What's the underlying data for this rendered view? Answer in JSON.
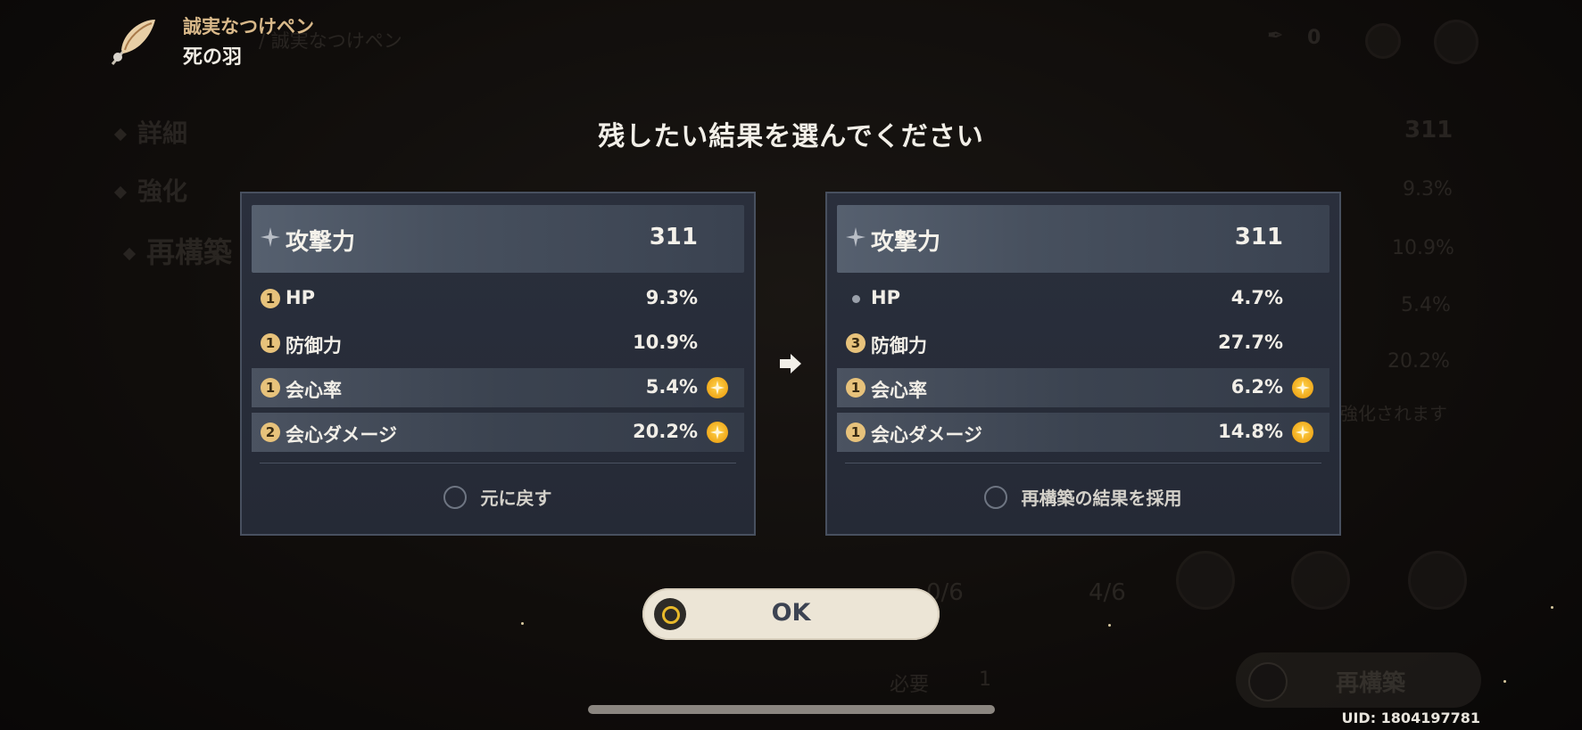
{
  "header": {
    "set_name": "誠実なつけペン",
    "piece_name": "死の羽",
    "icon": "feather-icon"
  },
  "background": {
    "breadcrumb": "/ 誠実なつけペン",
    "material_count": "0",
    "nav": [
      "詳細",
      "強化",
      "再構築"
    ],
    "stats": [
      "311",
      "9.3%",
      "10.9%",
      "5.4%",
      "20.2%"
    ],
    "note": "強化されます",
    "required_label": "必要",
    "required_count": "1",
    "progress_a": "0/6",
    "progress_b": "4/6",
    "reroll_label": "再構築"
  },
  "dialog": {
    "title": "残したい結果を選んでください",
    "left": {
      "main": {
        "name": "攻撃力",
        "value": "311"
      },
      "subs": [
        {
          "badge": "1",
          "name": "HP",
          "value": "9.3%",
          "upgraded": false,
          "highlight": false
        },
        {
          "badge": "1",
          "name": "防御力",
          "value": "10.9%",
          "upgraded": false,
          "highlight": false
        },
        {
          "badge": "1",
          "name": "会心率",
          "value": "5.4%",
          "upgraded": true,
          "highlight": true
        },
        {
          "badge": "2",
          "name": "会心ダメージ",
          "value": "20.2%",
          "upgraded": true,
          "highlight": true
        }
      ],
      "choice": "元に戻す"
    },
    "right": {
      "main": {
        "name": "攻撃力",
        "value": "311"
      },
      "subs": [
        {
          "badge": "",
          "name": "HP",
          "value": "4.7%",
          "upgraded": false,
          "highlight": false
        },
        {
          "badge": "3",
          "name": "防御力",
          "value": "27.7%",
          "upgraded": false,
          "highlight": false
        },
        {
          "badge": "1",
          "name": "会心率",
          "value": "6.2%",
          "upgraded": true,
          "highlight": true
        },
        {
          "badge": "1",
          "name": "会心ダメージ",
          "value": "14.8%",
          "upgraded": true,
          "highlight": true
        }
      ],
      "choice": "再構築の結果を採用"
    },
    "ok_label": "OK"
  },
  "footer": {
    "uid": "UID: 1804197781"
  },
  "colors": {
    "accent_gold": "#e7c27b",
    "panel_bg": "#272c38",
    "ok_bg": "#ece5d6"
  }
}
